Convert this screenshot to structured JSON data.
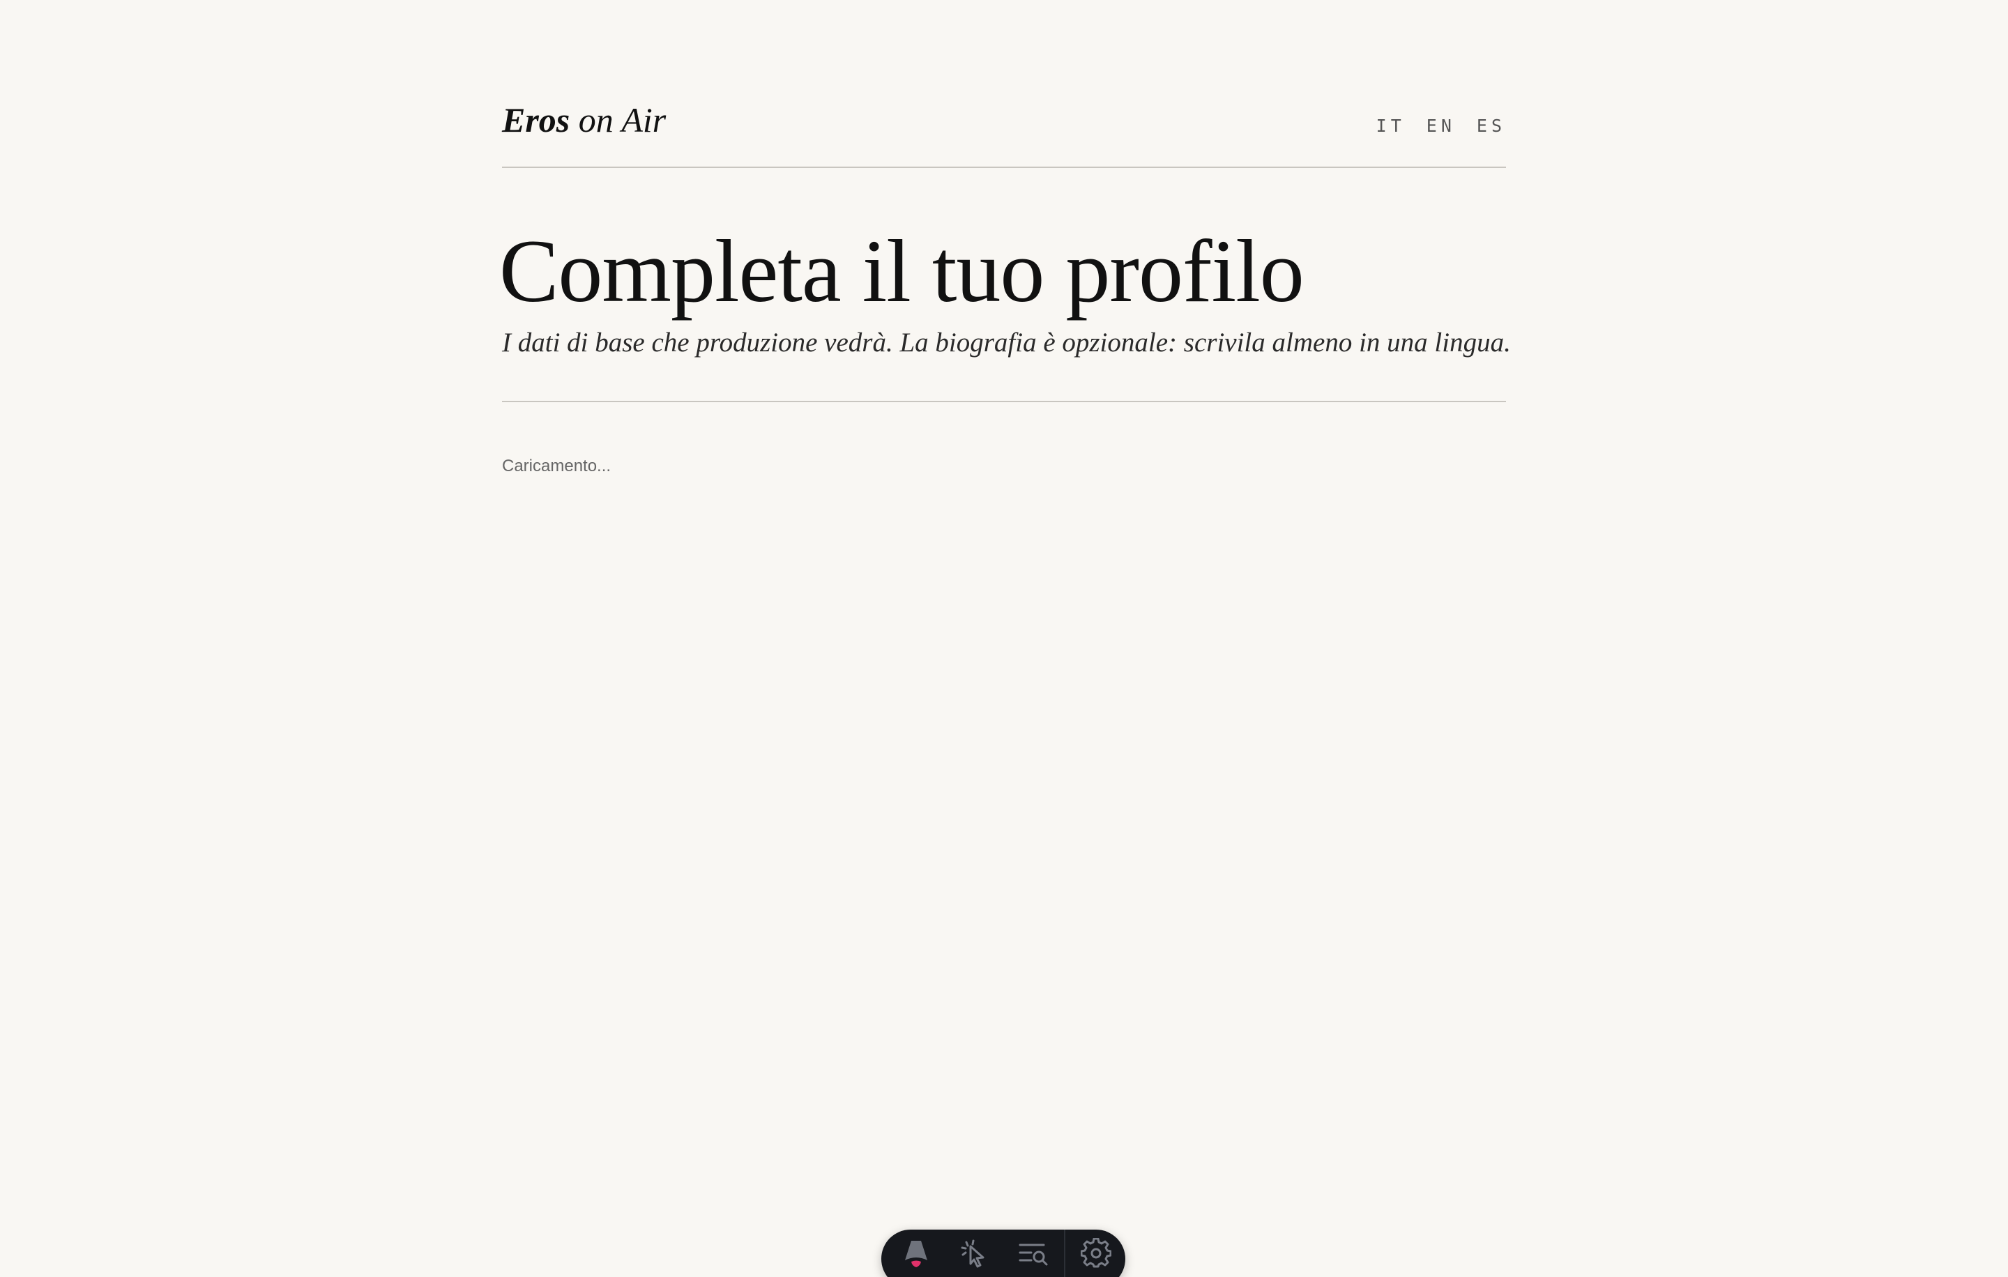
{
  "brand": {
    "name_strong": "Eros",
    "name_rest": "on Air"
  },
  "languages": [
    {
      "code": "IT"
    },
    {
      "code": "EN"
    },
    {
      "code": "ES"
    }
  ],
  "hero": {
    "title": "Completa il tuo profilo",
    "subtitle": "I dati di base che produzione vedrà. La biografia è opzionale: scrivila almeno in una lingua."
  },
  "status": {
    "loading_text": "Caricamento..."
  },
  "toolbar": {
    "items": [
      {
        "icon": "astro-logo-icon"
      },
      {
        "icon": "cursor-inspect-icon"
      },
      {
        "icon": "search-list-icon"
      },
      {
        "icon": "gear-icon"
      }
    ],
    "colors": {
      "background": "#16181d",
      "icon": "#7a7e88",
      "accent": "#e0326b"
    }
  }
}
